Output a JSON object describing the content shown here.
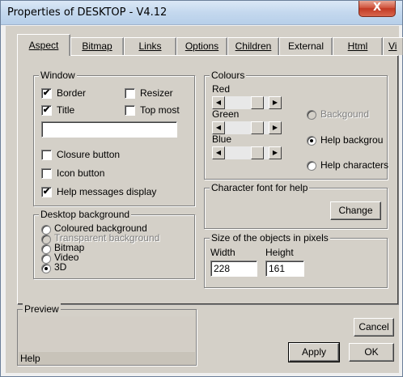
{
  "window": {
    "title": "Properties of DESKTOP - V4.12",
    "close_label": "X"
  },
  "tabs": [
    "Aspect",
    "Bitmap",
    "Links",
    "Options",
    "Children",
    "External",
    "Html",
    "Vi"
  ],
  "window_group": {
    "label": "Window",
    "border": {
      "label": "Border",
      "checked": true
    },
    "title": {
      "label": "Title",
      "checked": true
    },
    "resizer": {
      "label": "Resizer",
      "checked": false
    },
    "top_most": {
      "label": "Top most",
      "checked": false
    },
    "title_value": "",
    "closure_button": {
      "label": "Closure button",
      "checked": false
    },
    "icon_button": {
      "label": "Icon button",
      "checked": false
    },
    "help_messages": {
      "label": "Help messages display",
      "checked": true
    }
  },
  "desktop_background": {
    "label": "Desktop background",
    "options": [
      "Coloured background",
      "Transparent background",
      "Bitmap",
      "Video",
      "3D"
    ],
    "selected": "3D"
  },
  "colours": {
    "label": "Colours",
    "red_label": "Red",
    "green_label": "Green",
    "blue_label": "Blue",
    "targets": [
      "Backgound",
      "Help backgrou",
      "Help characters"
    ],
    "selected_target": "Help backgrou"
  },
  "font_group": {
    "label": "Character font for help",
    "change_label": "Change"
  },
  "size_group": {
    "label": "Size of the objects in pixels",
    "width_label": "Width",
    "width_value": "228",
    "height_label": "Height",
    "height_value": "161"
  },
  "preview": {
    "label": "Preview",
    "help_text": "Help"
  },
  "buttons": {
    "cancel": "Cancel",
    "apply": "Apply",
    "ok": "OK"
  }
}
